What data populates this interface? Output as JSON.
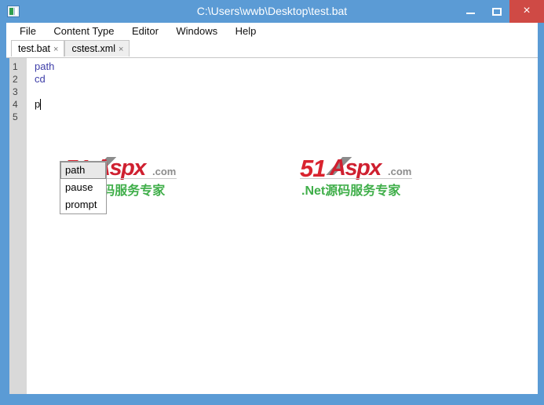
{
  "window": {
    "title": "C:\\Users\\wwb\\Desktop\\test.bat",
    "icon": "document-window-icon",
    "controls": {
      "minimize": "–",
      "maximize": "□",
      "close": "×"
    },
    "frame_color": "#5b9bd5",
    "close_color": "#cf4a45"
  },
  "menubar": {
    "items": [
      {
        "label": "File"
      },
      {
        "label": "Content Type"
      },
      {
        "label": "Editor"
      },
      {
        "label": "Windows"
      },
      {
        "label": "Help"
      }
    ]
  },
  "tabs": {
    "close_glyph": "×",
    "items": [
      {
        "label": "test.bat",
        "active": true
      },
      {
        "label": "cstest.xml",
        "active": false
      }
    ]
  },
  "editor": {
    "line_numbers": [
      "1",
      "2",
      "3",
      "4",
      "5"
    ],
    "lines": [
      {
        "number": "1",
        "text": "path",
        "style": "keyword"
      },
      {
        "number": "2",
        "text": "cd",
        "style": "keyword"
      },
      {
        "number": "3",
        "text": "",
        "style": "plain"
      },
      {
        "number": "4",
        "text": "p",
        "style": "plain"
      },
      {
        "number": "5",
        "text": "",
        "style": "plain"
      }
    ],
    "keyword_color": "#3d3da8",
    "caret_line": "4",
    "gutter_color": "#d9d9d9"
  },
  "autocomplete": {
    "items": [
      {
        "label": "path",
        "selected": true
      },
      {
        "label": "pause",
        "selected": false
      },
      {
        "label": "prompt",
        "selected": false
      }
    ]
  },
  "watermarks": [
    {
      "prefix": "51",
      "main": "Aspx",
      "suffix": ".com",
      "subtitle": ".Net源码服务专家",
      "red": "#d9232e",
      "gray": "#8c8c8c",
      "green": "#3fae49"
    },
    {
      "prefix": "51",
      "main": "Aspx",
      "suffix": ".com",
      "subtitle": ".Net源码服务专家",
      "red": "#d9232e",
      "gray": "#8c8c8c",
      "green": "#3fae49"
    }
  ]
}
